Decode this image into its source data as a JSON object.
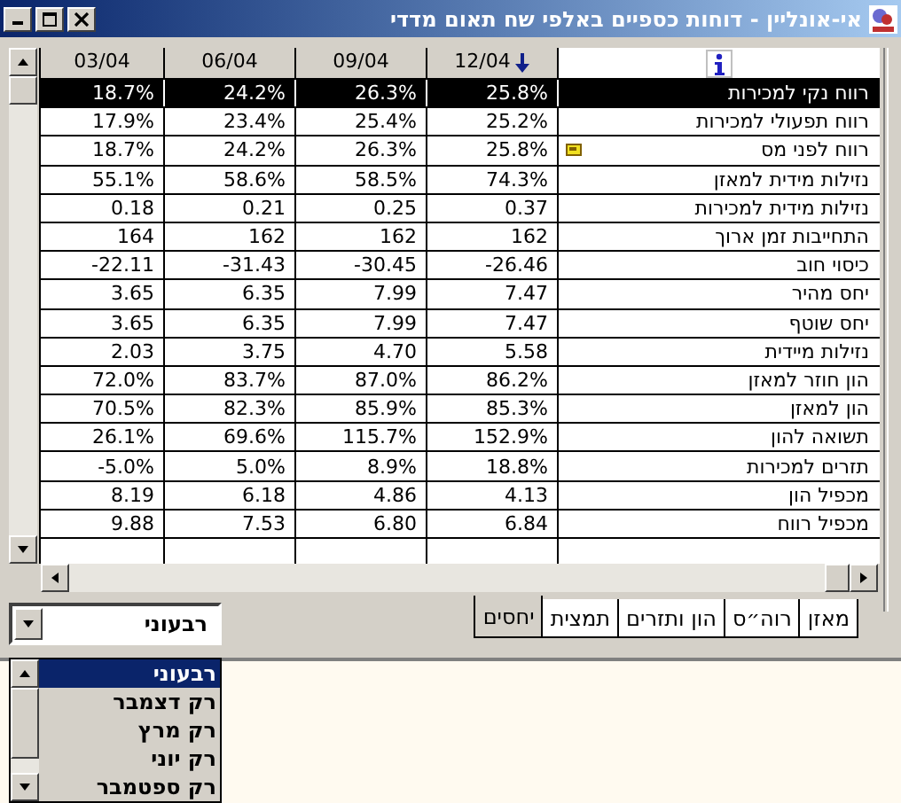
{
  "window": {
    "title": "אי-אונליין - דוחות כספיים באלפי שח תאום מדדי"
  },
  "table": {
    "columns": [
      {
        "label": "03/04",
        "sorted": false
      },
      {
        "label": "06/04",
        "sorted": false
      },
      {
        "label": "09/04",
        "sorted": false
      },
      {
        "label": "12/04",
        "sorted": true
      }
    ],
    "rows": [
      {
        "label": "רווח נקי למכירות",
        "values": [
          "18.7%",
          "24.2%",
          "26.3%",
          "25.8%"
        ],
        "selected": true,
        "note": false
      },
      {
        "label": "רווח תפעולי למכירות",
        "values": [
          "17.9%",
          "23.4%",
          "25.4%",
          "25.2%"
        ],
        "selected": false,
        "note": false
      },
      {
        "label": "רווח לפני מס",
        "values": [
          "18.7%",
          "24.2%",
          "26.3%",
          "25.8%"
        ],
        "selected": false,
        "note": true
      },
      {
        "label": "נזילות מידית למאזן",
        "values": [
          "55.1%",
          "58.6%",
          "58.5%",
          "74.3%"
        ],
        "selected": false,
        "note": false
      },
      {
        "label": "נזילות מידית למכירות",
        "values": [
          "0.18",
          "0.21",
          "0.25",
          "0.37"
        ],
        "selected": false,
        "note": false
      },
      {
        "label": "התחייבות זמן ארוך",
        "values": [
          "164",
          "162",
          "162",
          "162"
        ],
        "selected": false,
        "note": false
      },
      {
        "label": "כיסוי חוב",
        "values": [
          "-22.11",
          "-31.43",
          "-30.45",
          "-26.46"
        ],
        "selected": false,
        "note": false
      },
      {
        "label": "יחס מהיר",
        "values": [
          "3.65",
          "6.35",
          "7.99",
          "7.47"
        ],
        "selected": false,
        "note": false
      },
      {
        "label": "יחס שוטף",
        "values": [
          "3.65",
          "6.35",
          "7.99",
          "7.47"
        ],
        "selected": false,
        "note": false
      },
      {
        "label": "נזילות מיידית",
        "values": [
          "2.03",
          "3.75",
          "4.70",
          "5.58"
        ],
        "selected": false,
        "note": false
      },
      {
        "label": "הון חוזר למאזן",
        "values": [
          "72.0%",
          "83.7%",
          "87.0%",
          "86.2%"
        ],
        "selected": false,
        "note": false
      },
      {
        "label": "הון למאזן",
        "values": [
          "70.5%",
          "82.3%",
          "85.9%",
          "85.3%"
        ],
        "selected": false,
        "note": false
      },
      {
        "label": "תשואה להון",
        "values": [
          "26.1%",
          "69.6%",
          "115.7%",
          "152.9%"
        ],
        "selected": false,
        "note": false
      },
      {
        "label": "תזרים למכירות",
        "values": [
          "-5.0%",
          "5.0%",
          "8.9%",
          "18.8%"
        ],
        "selected": false,
        "note": false
      },
      {
        "label": "מכפיל הון",
        "values": [
          "8.19",
          "6.18",
          "4.86",
          "4.13"
        ],
        "selected": false,
        "note": false
      },
      {
        "label": "מכפיל רווח",
        "values": [
          "9.88",
          "7.53",
          "6.80",
          "6.84"
        ],
        "selected": false,
        "note": false
      }
    ]
  },
  "tabs": [
    {
      "label": "מאזן",
      "selected": false
    },
    {
      "label": "רוה״ס",
      "selected": false
    },
    {
      "label": "הון ותזרים",
      "selected": false
    },
    {
      "label": "תמצית",
      "selected": false
    },
    {
      "label": "יחסים",
      "selected": true
    }
  ],
  "period_dropdown": {
    "value": "רבעוני",
    "expanded": true,
    "options": [
      {
        "label": "רבעוני",
        "selected": true
      },
      {
        "label": "רק דצמבר",
        "selected": false
      },
      {
        "label": "רק מרץ",
        "selected": false
      },
      {
        "label": "רק יוני",
        "selected": false
      },
      {
        "label": "רק ספטמבר",
        "selected": false
      }
    ]
  }
}
